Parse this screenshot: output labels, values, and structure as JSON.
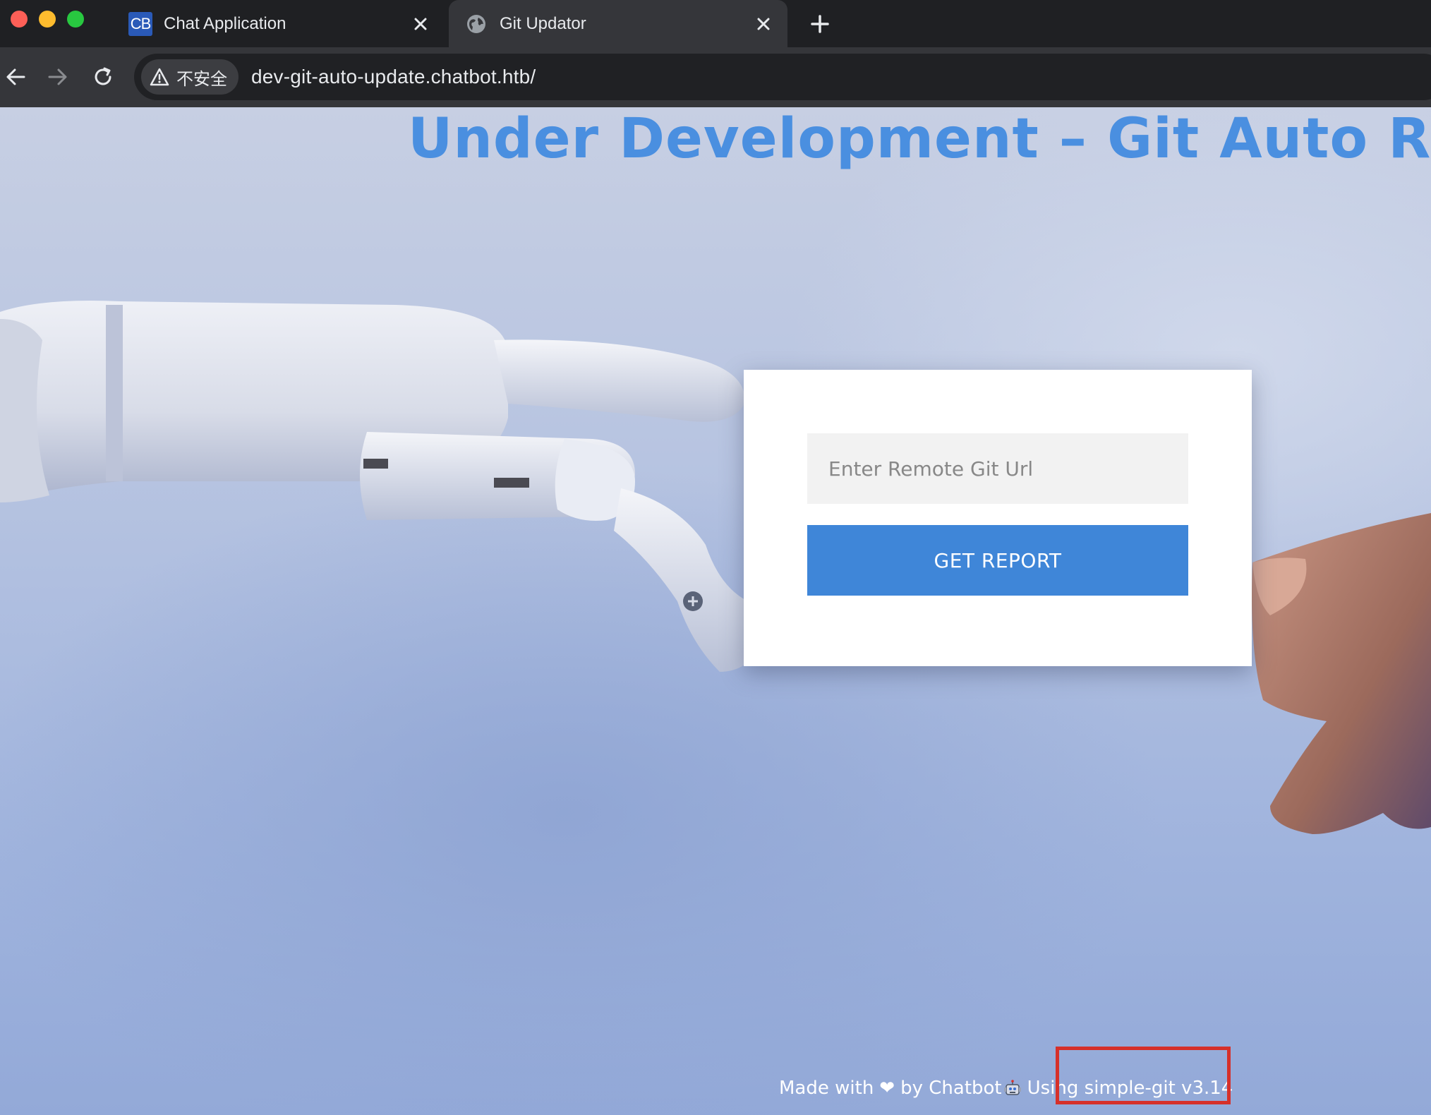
{
  "browser": {
    "tabs": [
      {
        "favicon_text": "CB",
        "title": "Chat Application",
        "active": false
      },
      {
        "title": "Git Updator",
        "active": true
      }
    ],
    "security_label": "不安全",
    "url": "dev-git-auto-update.chatbot.htb/"
  },
  "page": {
    "headline": "Under Development – Git Auto Report Ger",
    "form": {
      "input_placeholder": "Enter Remote Git Url",
      "input_value": "",
      "button_label": "GET REPORT"
    },
    "footer": {
      "made_with": "Made with",
      "heart": "❤",
      "by": "by Chatbot",
      "using": "Using simple-git v3.14"
    }
  },
  "colors": {
    "headline": "#4a8fe0",
    "button": "#3f86d8",
    "highlight": "#d6302a"
  }
}
